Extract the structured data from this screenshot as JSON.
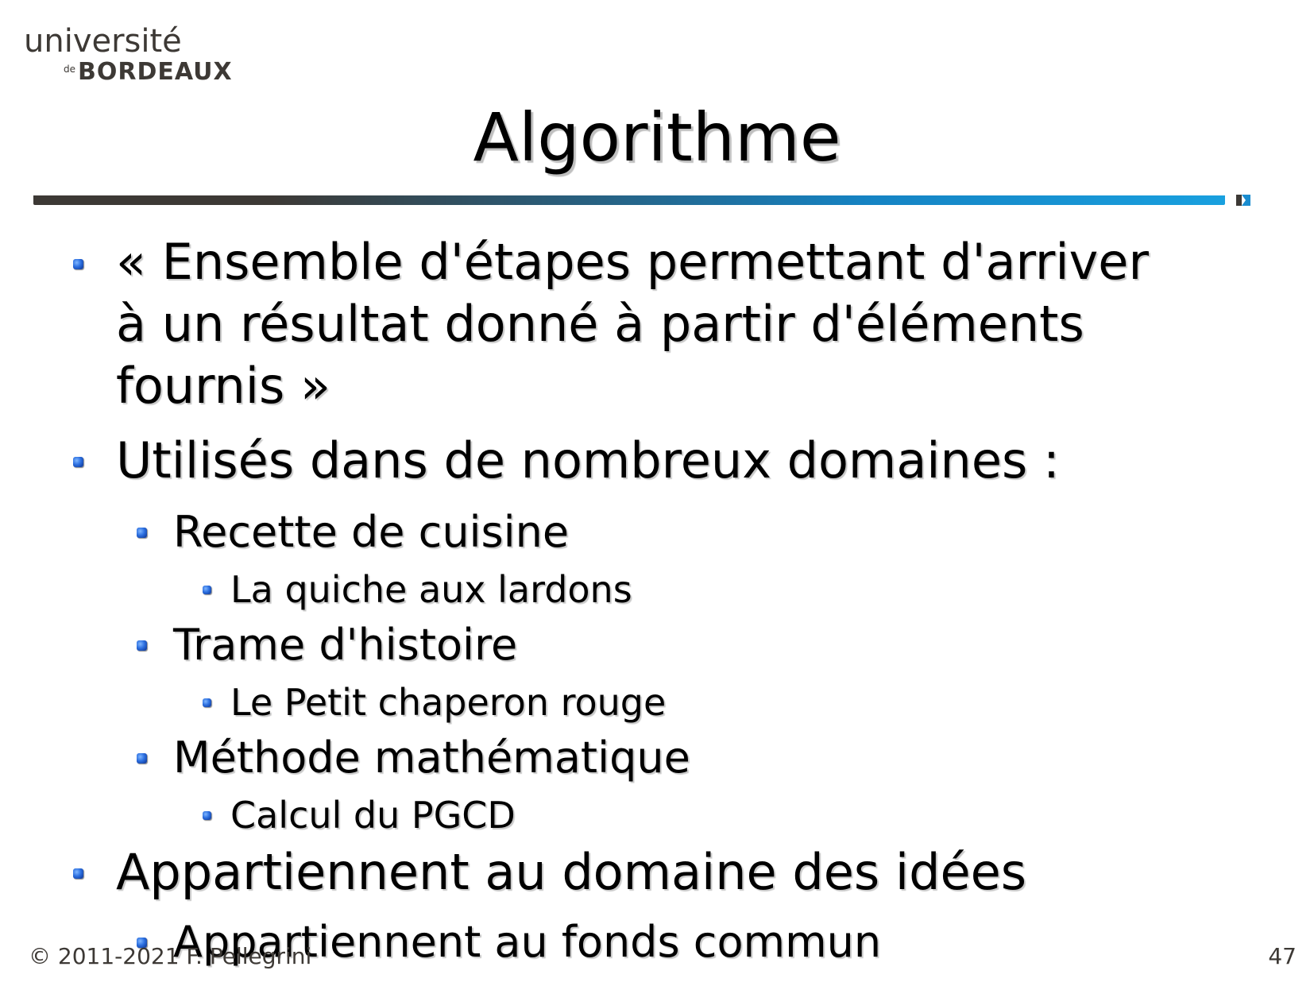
{
  "logo": {
    "line1": "université",
    "de": "de",
    "line2": "BORDEAUX"
  },
  "title": "Algorithme",
  "bullets": {
    "b1_line1": "« Ensemble d'étapes permettant d'arriver",
    "b1_line2": "à un résultat donné à partir d'éléments",
    "b1_line3": "fournis »",
    "b2": "Utilisés dans de nombreux domaines :",
    "b2_1": "Recette de cuisine",
    "b2_1_1": "La quiche aux lardons",
    "b2_2": "Trame d'histoire",
    "b2_2_1": "Le Petit chaperon rouge",
    "b2_3": "Méthode mathématique",
    "b2_3_1": "Calcul du PGCD",
    "b3": "Appartiennent au domaine des idées",
    "b3_1": "Appartiennent au fonds commun"
  },
  "footer": {
    "copyright": "© 2011-2021 F. Pellegrini",
    "page_number": "47"
  },
  "colors": {
    "accent_blue": "#1a8ccf",
    "brand_dark": "#3d3935"
  }
}
